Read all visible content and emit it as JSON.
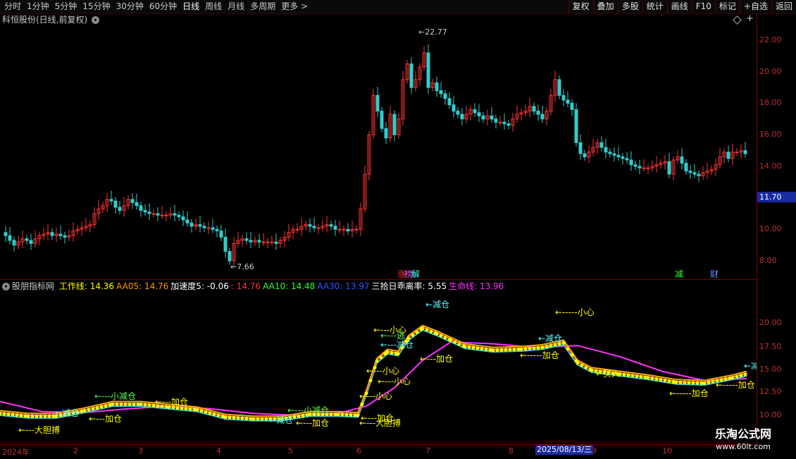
{
  "toolbar": {
    "left_tabs": [
      "分时",
      "1分钟",
      "5分钟",
      "15分钟",
      "30分钟",
      "60分钟",
      "日线",
      "周线",
      "月线",
      "多周期",
      "更多 >"
    ],
    "active_tab": "日线",
    "right_buttons": [
      "复权",
      "叠加",
      "多股",
      "统计",
      "画线",
      "F10",
      "标记",
      "+自选",
      "返回"
    ]
  },
  "stock": {
    "title": "科恒股份(日线,前复权)",
    "high_label": "22.77",
    "low_label": "7.66",
    "current_price": "11.70",
    "price_ticks": [
      "22.00",
      "20.00",
      "18.00",
      "16.00",
      "14.00",
      "10.00",
      "8.00"
    ],
    "event_markers": [
      {
        "text": "涨",
        "color": "#ff3333"
      },
      {
        "text": "榜",
        "color": "#ff55ff"
      },
      {
        "text": "解",
        "color": "#55ffff"
      },
      {
        "text": "减",
        "color": "#33ff33"
      },
      {
        "text": "财",
        "color": "#5599ff"
      }
    ]
  },
  "indicator": {
    "name": "股朋指标网",
    "legend": [
      {
        "label": "工作线: ",
        "value": "14.36",
        "color": "#ffff00"
      },
      {
        "label": "AA05: ",
        "value": "14.76",
        "color": "#ff9900"
      },
      {
        "label": "加速度5: ",
        "value": "-0.06",
        "color": "#ffffff"
      },
      {
        "label": ": ",
        "value": "14.76",
        "color": "#ff3333"
      },
      {
        "label": "AA10: ",
        "value": "14.48",
        "color": "#33ff33"
      },
      {
        "label": "AA30: ",
        "value": "13.97",
        "color": "#3355ff"
      },
      {
        "label": "三拾日乖离率: ",
        "value": "5.55",
        "color": "#ffffff"
      },
      {
        "label": "生命线: ",
        "value": "13.96",
        "color": "#ff33ff"
      }
    ],
    "ticks": [
      "20.00",
      "17.50",
      "15.00",
      "12.50",
      "10.00"
    ],
    "annotations": [
      {
        "text": "←---大胆搏",
        "color": "#ffff00"
      },
      {
        "text": "←减仓",
        "color": "#55ffff"
      },
      {
        "text": "←---加仓",
        "color": "#ffff00"
      },
      {
        "text": "←---小减仓",
        "color": "#55ff55"
      },
      {
        "text": "←---加仓",
        "color": "#ffff00"
      },
      {
        "text": "←减仓",
        "color": "#55ffff"
      },
      {
        "text": "←---加仓",
        "color": "#ffff00"
      },
      {
        "text": "←---小减仓",
        "color": "#55ff55"
      },
      {
        "text": "←---大胆搏",
        "color": "#ffff00"
      },
      {
        "text": "←---加仓",
        "color": "#ffff00"
      },
      {
        "text": "←---小心",
        "color": "#ffff00"
      },
      {
        "text": "←---小心",
        "color": "#ffff00"
      },
      {
        "text": "←---小心",
        "color": "#ffff00"
      },
      {
        "text": "←---减仓",
        "color": "#55ffff"
      },
      {
        "text": "←---逃",
        "color": "#55ff55"
      },
      {
        "text": "←---小心",
        "color": "#ffff00"
      },
      {
        "text": "←---加仓",
        "color": "#ffff00"
      },
      {
        "text": "←减仓",
        "color": "#55ffff"
      },
      {
        "text": "←-----小心",
        "color": "#ffff00"
      },
      {
        "text": "←减仓",
        "color": "#55ffff"
      },
      {
        "text": "←-----加仓",
        "color": "#ffff00"
      },
      {
        "text": "←买入",
        "color": "#ffff00"
      },
      {
        "text": "←-----加仓",
        "color": "#ffff00"
      },
      {
        "text": "←-----加仓",
        "color": "#ffff00"
      },
      {
        "text": "←减",
        "color": "#55ffff"
      }
    ]
  },
  "date_axis": {
    "labels": [
      "2024年",
      "2",
      "3",
      "4",
      "5",
      "6",
      "7",
      "8",
      "9",
      "10"
    ],
    "selected_date": "2025/08/13/三"
  },
  "watermark": {
    "title": "乐淘公式网",
    "url": "www.60lt.com"
  },
  "colors": {
    "up": "#ff3333",
    "down": "#33cccc",
    "axis": "#7a0000",
    "life_line": "#ff33ff",
    "work_line": "#ffff00"
  }
}
